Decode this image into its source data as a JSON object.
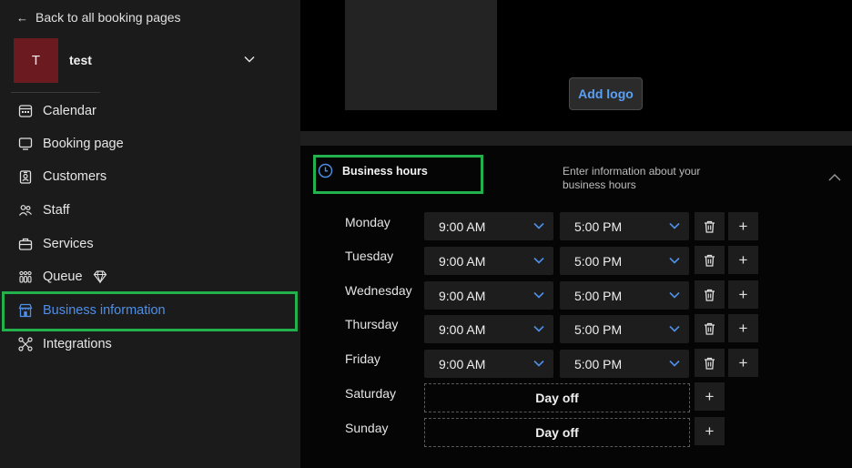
{
  "sidebar": {
    "back_label": "Back to all booking pages",
    "account": {
      "initial": "T",
      "name": "test"
    },
    "nav": [
      {
        "label": "Calendar",
        "icon": "calendar-icon"
      },
      {
        "label": "Booking page",
        "icon": "monitor-icon"
      },
      {
        "label": "Customers",
        "icon": "id-badge-icon"
      },
      {
        "label": "Staff",
        "icon": "people-icon"
      },
      {
        "label": "Services",
        "icon": "briefcase-icon"
      },
      {
        "label": "Queue",
        "icon": "queue-icon",
        "badge_icon": "diamond-icon"
      },
      {
        "label": "Business information",
        "icon": "storefront-icon",
        "active": true
      },
      {
        "label": "Integrations",
        "icon": "integrations-icon"
      }
    ]
  },
  "main": {
    "add_logo_label": "Add logo",
    "business_hours": {
      "title": "Business hours",
      "description": "Enter information about your business hours",
      "days": [
        {
          "day": "Monday",
          "start": "9:00 AM",
          "end": "5:00 PM"
        },
        {
          "day": "Tuesday",
          "start": "9:00 AM",
          "end": "5:00 PM"
        },
        {
          "day": "Wednesday",
          "start": "9:00 AM",
          "end": "5:00 PM"
        },
        {
          "day": "Thursday",
          "start": "9:00 AM",
          "end": "5:00 PM"
        },
        {
          "day": "Friday",
          "start": "9:00 AM",
          "end": "5:00 PM"
        },
        {
          "day": "Saturday",
          "status": "Day off"
        },
        {
          "day": "Sunday",
          "status": "Day off"
        }
      ]
    }
  },
  "colors": {
    "accent": "#4f8fe8",
    "highlight": "#22b14c",
    "avatar": "#6b1a1f"
  }
}
